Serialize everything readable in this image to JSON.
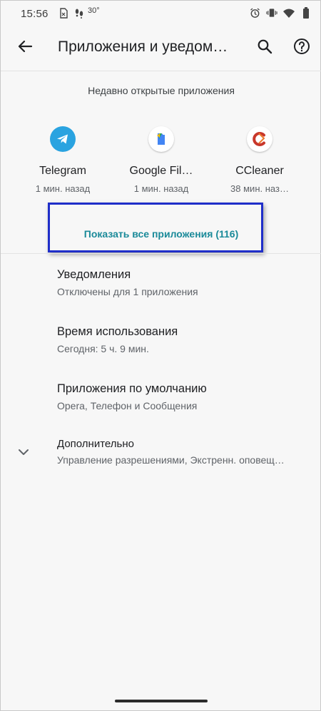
{
  "status_bar": {
    "time": "15:56",
    "temperature": "30°",
    "left_icons": [
      "sim-card-icon",
      "footprints-icon"
    ],
    "right_icons": [
      "alarm-icon",
      "vibrate-icon",
      "wifi-icon",
      "battery-icon"
    ]
  },
  "app_bar": {
    "title": "Приложения и уведом…",
    "back_icon": "arrow-back-icon",
    "search_icon": "search-icon",
    "help_icon": "help-icon"
  },
  "recent": {
    "header": "Недавно открытые приложения",
    "apps": [
      {
        "name": "Telegram",
        "ago": "1 мин. назад",
        "icon": "telegram-icon",
        "color": "#2aa3e0"
      },
      {
        "name": "Google Fil…",
        "ago": "1 мин. назад",
        "icon": "google-files-icon",
        "color": "#3b7ddd"
      },
      {
        "name": "CCleaner",
        "ago": "38 мин. наз…",
        "icon": "ccleaner-icon",
        "color": "#c8372b"
      }
    ],
    "show_all": "Показать все приложения (116)"
  },
  "preferences": [
    {
      "title": "Уведомления",
      "summary": "Отключены для 1 приложения"
    },
    {
      "title": "Время использования",
      "summary": "Сегодня: 5 ч. 9 мин."
    },
    {
      "title": "Приложения по умолчанию",
      "summary": "Opera, Телефон и Сообщения"
    },
    {
      "title": "Дополнительно",
      "summary": "Управление разрешениями, Экстренн. оповещ…",
      "icon": "chevron-down-icon"
    }
  ],
  "colors": {
    "accent": "#1a8a99",
    "highlight_border": "#1f2ec9",
    "background": "#f7f7f7"
  }
}
